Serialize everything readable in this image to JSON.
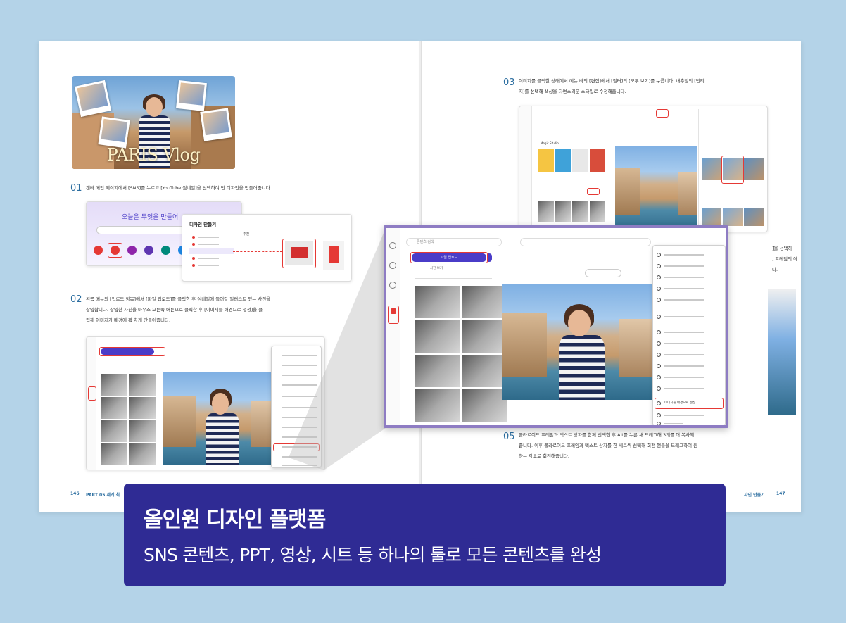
{
  "left_page": {
    "hero": {
      "title": "PARIS Vlog"
    },
    "step1": {
      "number": "01",
      "text": "캔바 메인 페이지에서 [SNS]를 누르고 [YouTube 썸네일]을 선택하여 빈 디자인을 만들어줍니다."
    },
    "step1_ui": {
      "search_title": "오늘은 무엇을 만들어",
      "dropdown_title": "디자인 만들기",
      "dropdown_subtitle": "추천"
    },
    "step2": {
      "number": "02",
      "lines": [
        "왼쪽 메뉴의 [업로드 항목]에서 [파일 업로드]를 클릭한 후 섬네일에 들어갈 일러스트 있는 사진을",
        "삽입합니다. 삽입한 사진을 마우스 오른쪽 버튼으로 클릭한 후 [이미지를 배경으로 설정]을 클",
        "릭해 이미지가 배경에 꽉 차게 만들어줍니다."
      ]
    },
    "footer": {
      "page": "146",
      "section": "PART 05 세계 최"
    }
  },
  "right_page": {
    "step3": {
      "number": "03",
      "lines": [
        "이미지를 클릭한 상태에서 메뉴 바의 [편집]에서 [필터]의 [모두 보기]를 누릅니다. 내추럴의 [빈티",
        "지]를 선택해 색상을 자연스러운 스타일로 수정해줍니다."
      ]
    },
    "step3_ui": {
      "filter_label": "Magic Studio"
    },
    "step5": {
      "number": "05",
      "lines": [
        "폴라로이드 프레임과 텍스트 상자를 함께 선택한 후 Alt를 누른 채 드래그해 3개를 더 복사해",
        "줍니다. 이후 폴라로이드 프레임과 텍스트 상자를 한 세트씩 선택해 회전 핸들을 드래그하여 원",
        "하는 각도로 회전해줍니다."
      ]
    },
    "side_fragments": [
      "]을 선택하",
      ", 프레임의 아",
      "다."
    ],
    "footer": {
      "section": "자인 만들기",
      "page": "147"
    }
  },
  "zoom_ui": {
    "search_placeholder": "콘텐츠 검색",
    "upload_button": "파일 업로드",
    "photo_button": "사진 보기",
    "menu_highlight": "이미지를 배경으로 설정"
  },
  "banner": {
    "title": "올인원 디자인 플랫폼",
    "subtitle": "SNS 콘텐츠, PPT, 영상, 시트 등 하나의 툴로 모든 콘텐츠를 완성"
  },
  "colors": {
    "background": "#b4d3e8",
    "banner": "#2f2b94",
    "accent_purple": "#8e7cc3",
    "highlight_red": "#e53935",
    "step_number_blue": "#2c6ea0"
  }
}
